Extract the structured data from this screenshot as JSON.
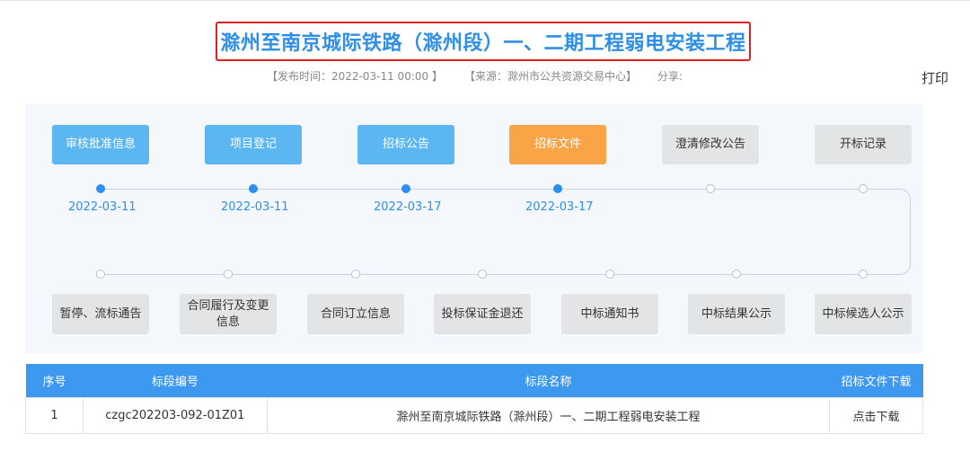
{
  "title": "滁州至南京城际铁路（滁州段）一、二期工程弱电安装工程",
  "meta": {
    "publish": "【发布时间：2022-03-11 00:00 】",
    "source": "【来源：滁州市公共资源交易中心】",
    "share": "分享:",
    "print": "打印"
  },
  "flow": {
    "top_steps": [
      {
        "label": "审核批准信息",
        "date": "2022-03-11"
      },
      {
        "label": "项目登记",
        "date": "2022-03-11"
      },
      {
        "label": "招标公告",
        "date": "2022-03-17"
      },
      {
        "label": "招标文件",
        "date": "2022-03-17"
      },
      {
        "label": "澄清修改公告",
        "date": ""
      },
      {
        "label": "开标记录",
        "date": ""
      }
    ],
    "bottom_steps": [
      {
        "label": "暂停、流标通告"
      },
      {
        "label": "合同履行及变更信息"
      },
      {
        "label": "合同订立信息"
      },
      {
        "label": "投标保证金退还"
      },
      {
        "label": "中标通知书"
      },
      {
        "label": "中标结果公示"
      },
      {
        "label": "中标候选人公示"
      }
    ]
  },
  "table": {
    "headers": [
      "序号",
      "标段编号",
      "标段名称",
      "招标文件下载"
    ],
    "rows": [
      [
        "1",
        "czgc202203-092-01Z01",
        "滁州至南京城际铁路（滁州段）一、二期工程弱电安装工程",
        "点击下载"
      ]
    ]
  },
  "colors": {
    "accent": "#2f8fe6",
    "active_step": "#f9a446",
    "completed_step": "#5cb6f1",
    "pending_step": "#e3e4e5",
    "title_border": "#e02020"
  }
}
